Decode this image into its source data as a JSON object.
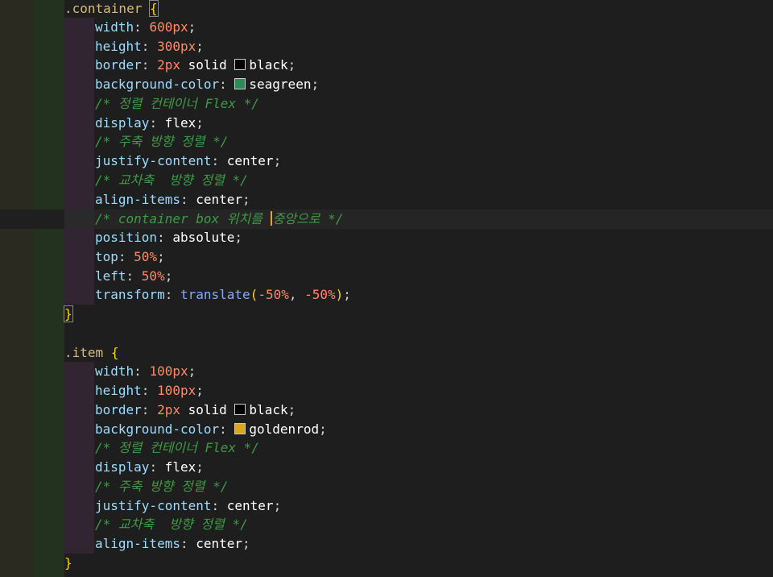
{
  "editor": {
    "colors": {
      "selector": "#d7ba7d",
      "property": "#9cdcfe",
      "number": "#ff8a65",
      "value": "#ffffff",
      "comment": "#3f9a46",
      "function": "#82aaff",
      "brace": "#ffd700",
      "cursor": "#f0a030"
    },
    "container": {
      "selector": ".container",
      "open_brace": "{",
      "width_prop": "width",
      "width_num": "600px",
      "height_prop": "height",
      "height_num": "300px",
      "border_prop": "border",
      "border_num": "2px",
      "border_style": "solid",
      "border_color_name": "black",
      "border_swatch": "#000000",
      "bg_prop": "background-color",
      "bg_color_name": "seagreen",
      "bg_swatch": "#2e8b57",
      "comment_1": "/* 정렬 컨테이너 Flex */",
      "display_prop": "display",
      "display_val": "flex",
      "comment_2": "/* 주축 방향 정렬 */",
      "justify_prop": "justify-content",
      "justify_val": "center",
      "comment_3": "/* 교차축  방향 정렬 */",
      "align_prop": "align-items",
      "align_val": "center",
      "comment_4_before": "/* container box 위치를 ",
      "comment_4_after": "중앙으로 */",
      "position_prop": "position",
      "position_val": "absolute",
      "top_prop": "top",
      "top_num": "50%",
      "left_prop": "left",
      "left_num": "50%",
      "transform_prop": "transform",
      "transform_fn": "translate",
      "transform_arg1": "-50%",
      "transform_arg2": "-50%",
      "close_brace": "}"
    },
    "item": {
      "selector": ".item",
      "open_brace": "{",
      "width_prop": "width",
      "width_num": "100px",
      "height_prop": "height",
      "height_num": "100px",
      "border_prop": "border",
      "border_num": "2px",
      "border_style": "solid",
      "border_color_name": "black",
      "border_swatch": "#000000",
      "bg_prop": "background-color",
      "bg_color_name": "goldenrod",
      "bg_swatch": "#daa520",
      "comment_1": "/* 정렬 컨테이너 Flex */",
      "display_prop": "display",
      "display_val": "flex",
      "comment_2": "/* 주축 방향 정렬 */",
      "justify_prop": "justify-content",
      "justify_val": "center",
      "comment_3": "/* 교차축  방향 정렬 */",
      "align_prop": "align-items",
      "align_val": "center",
      "close_brace": "}"
    }
  }
}
